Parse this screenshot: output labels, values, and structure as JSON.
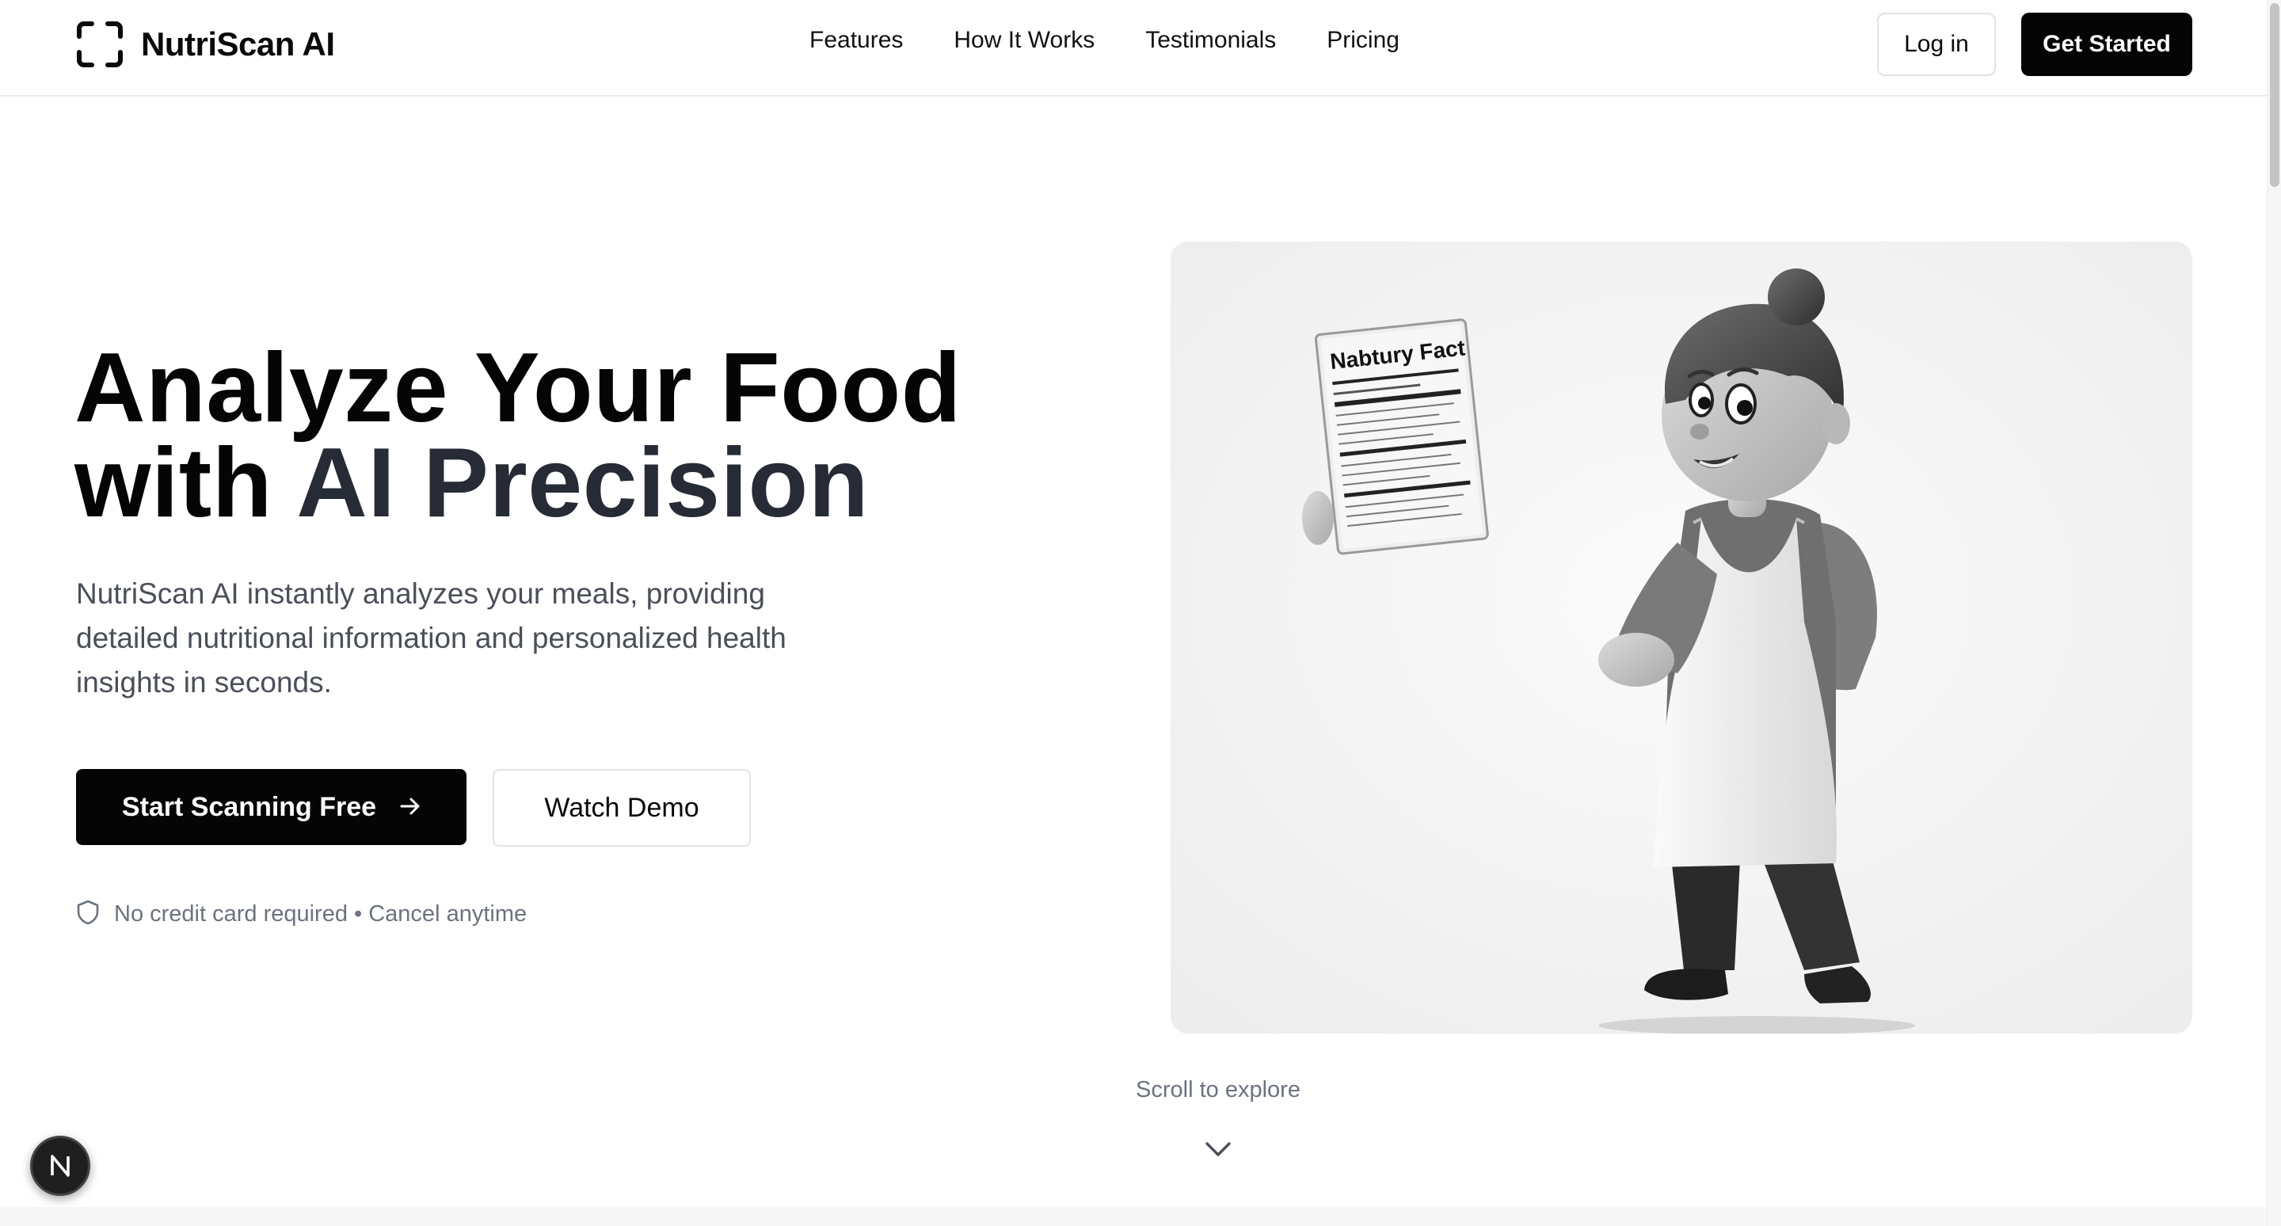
{
  "brand": {
    "name": "NutriScan AI",
    "icon": "scan-frame-icon"
  },
  "nav": {
    "items": [
      {
        "label": "Features"
      },
      {
        "label": "How It Works"
      },
      {
        "label": "Testimonials"
      },
      {
        "label": "Pricing"
      }
    ]
  },
  "header": {
    "login_label": "Log in",
    "get_started_label": "Get Started"
  },
  "hero": {
    "headline_line1": "Analyze Your Food",
    "headline_line2_prefix": "with ",
    "headline_line2_accent": "AI Precision",
    "subtext": "NutriScan AI instantly analyzes your meals, providing detailed nutritional information and personalized health insights in seconds.",
    "primary_cta": "Start Scanning Free",
    "secondary_cta": "Watch Demo",
    "trust_note": "No credit card required • Cancel anytime",
    "illustration_label_title": "Nabtury Fact"
  },
  "scroll_hint": "Scroll to explore",
  "badge": {
    "letter": "N"
  },
  "colors": {
    "primary": "#050505",
    "accent_text": "#262b36",
    "muted": "#6b7280",
    "border": "#e3e3e3"
  },
  "icons": {
    "arrow": "arrow-right-icon",
    "shield": "shield-icon",
    "chevron": "chevron-down-icon"
  }
}
